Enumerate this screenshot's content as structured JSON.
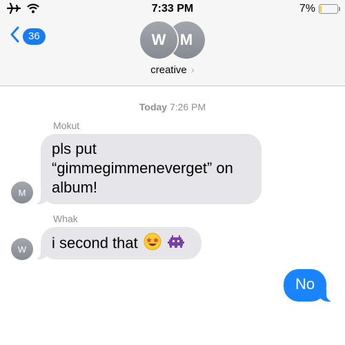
{
  "status_bar": {
    "time": "7:33 PM",
    "battery_percent": "7%",
    "battery_level": 0.07,
    "icons": [
      "airplane-mode-icon",
      "wifi-icon",
      "battery-icon"
    ]
  },
  "header": {
    "back_count": "36",
    "avatars": [
      {
        "initial": "W"
      },
      {
        "initial": "M"
      }
    ],
    "group_name": "creative",
    "group_chevron": "›"
  },
  "conversation": {
    "timestamp_day": "Today",
    "timestamp_time": "7:26 PM",
    "messages": [
      {
        "sender": "Mokut",
        "avatar_initial": "M",
        "lines": [
          "pls put",
          "“gimmegimmeneverget” on",
          "album!"
        ],
        "direction": "incoming"
      },
      {
        "sender": "Whak",
        "avatar_initial": "W",
        "text": "i second that",
        "emojis": [
          "star-struck-emoji",
          "alien-monster-emoji"
        ],
        "direction": "incoming"
      },
      {
        "text": "No",
        "direction": "outgoing"
      }
    ]
  },
  "colors": {
    "accent": "#1a84ff",
    "incoming_bubble": "#e5e5ea",
    "header_bg": "#f6f6f7",
    "battery_low": "#f5c518"
  }
}
